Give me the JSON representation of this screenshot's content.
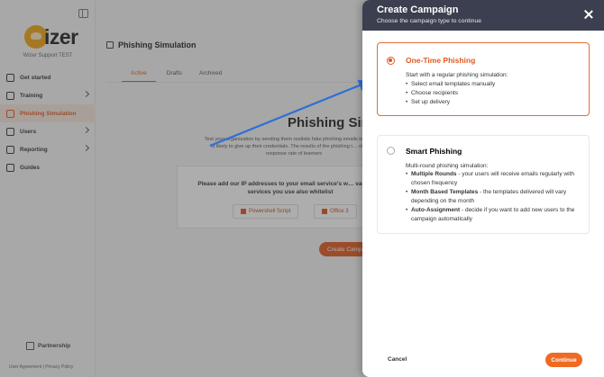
{
  "sidebar": {
    "logo_text": "izer",
    "org_name": "Wizer Support TEST",
    "items": [
      {
        "label": "Get started",
        "has_chevron": false,
        "active": false
      },
      {
        "label": "Training",
        "has_chevron": true,
        "active": false
      },
      {
        "label": "Phishing Simulation",
        "has_chevron": false,
        "active": true
      },
      {
        "label": "Users",
        "has_chevron": true,
        "active": false
      },
      {
        "label": "Reporting",
        "has_chevron": true,
        "active": false
      },
      {
        "label": "Guides",
        "has_chevron": false,
        "active": false
      }
    ],
    "partnership": "Partnership",
    "footer": "User Agreement  |  Privacy Policy"
  },
  "main": {
    "title": "Phishing Simulation",
    "tabs": [
      "Active",
      "Drafts",
      "Archived"
    ],
    "hero_title": "Phishing Sim",
    "hero_desc": "Test your organization by sending them realistic fake phishing emails to see who is likely to give up their credentials. The results of the phishing t… risk and response rate of learners",
    "ip_notice": "Please add our IP addresses to your email service's w… validation services you use also whitelist",
    "powershell_label": "Powershell Script",
    "office_label": "Office 3",
    "create_label": "Create Campa"
  },
  "modal": {
    "title": "Create Campaign",
    "subtitle": "Choose the campaign type to continue",
    "options": [
      {
        "title": "One-Time Phishing",
        "intro": "Start with a regular phishing simulation:",
        "bullets": [
          {
            "bold": "",
            "text": "Select email templates manually"
          },
          {
            "bold": "",
            "text": "Choose recipients"
          },
          {
            "bold": "",
            "text": "Set up delivery"
          }
        ]
      },
      {
        "title": "Smart Phishing",
        "intro": "Multi-round phishing simulation:",
        "bullets": [
          {
            "bold": "Multiple Rounds",
            "text": " - your users will receive emails regularly with chosen frequency"
          },
          {
            "bold": "Month Based Templates",
            "text": " - the templates delivered will vary depending on the month"
          },
          {
            "bold": "Auto-Assignment",
            "text": " - decide if you want to add new users to the campaign automatically"
          }
        ]
      }
    ],
    "selected_index": 0,
    "cancel_label": "Cancel",
    "continue_label": "Continue"
  },
  "colors": {
    "accent": "#e05a1f",
    "header_bg": "#3b3f4f",
    "annotation_arrow": "#2f6fd6"
  }
}
